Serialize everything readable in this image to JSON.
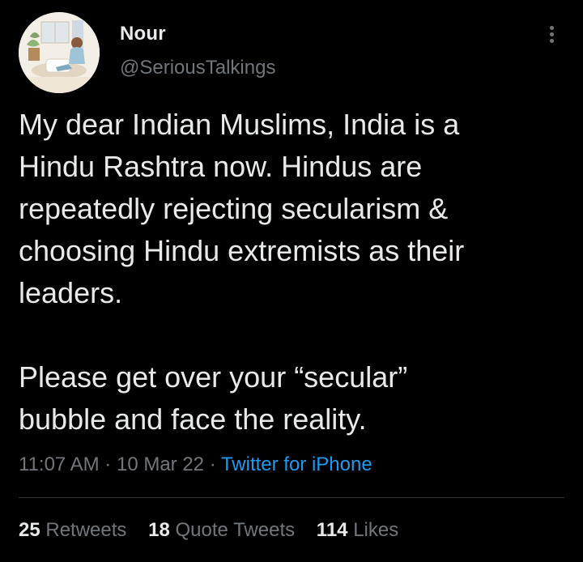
{
  "author": {
    "name": "Nour",
    "handle": "@SeriousTalkings",
    "avatar": "avatar-illustration"
  },
  "tweet": {
    "text": "My dear Indian Muslims, India is a\nHindu Rashtra now. Hindus are\nrepeatedly rejecting secularism &\nchoosing Hindu extremists as their\nleaders.\n\nPlease get over your “secular”\nbubble and face the reality.",
    "time": "11:07 AM",
    "date": "10 Mar 22",
    "source": "Twitter for iPhone",
    "separator": "·"
  },
  "stats": {
    "retweets": {
      "count": "25",
      "label": "Retweets"
    },
    "quotes": {
      "count": "18",
      "label": "Quote Tweets"
    },
    "likes": {
      "count": "114",
      "label": "Likes"
    }
  },
  "icons": {
    "more": "more-vertical-icon"
  },
  "colors": {
    "background": "#000000",
    "text": "#e7e9ea",
    "secondary": "#71767b",
    "link": "#1d9bf0",
    "divider": "#2f3336"
  }
}
